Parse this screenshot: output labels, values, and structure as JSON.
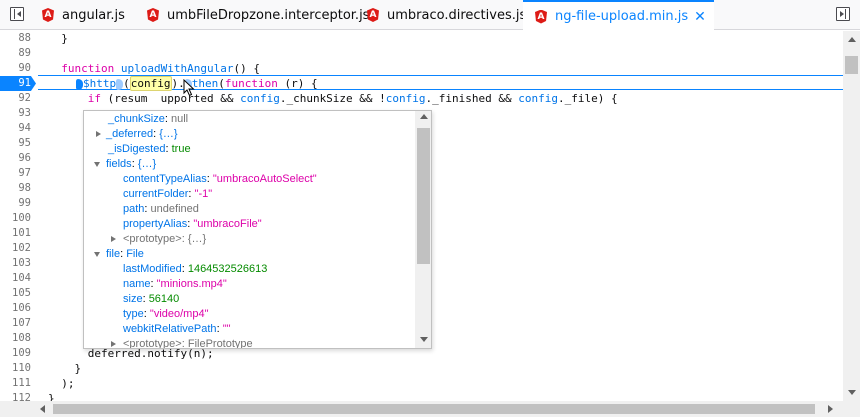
{
  "tabs": [
    {
      "label": "angular.js",
      "active": false
    },
    {
      "label": "umbFileDropzone.interceptor.js",
      "active": false
    },
    {
      "label": "umbraco.directives.js",
      "active": false
    },
    {
      "label": "ng-file-upload.min.js",
      "active": true
    }
  ],
  "tab_icon_letter": "A",
  "close_glyph": "✕",
  "editor": {
    "lines": [
      {
        "n": "88",
        "code": "  }"
      },
      {
        "n": "89",
        "code": ""
      },
      {
        "n": "90",
        "code": "  function uploadWithAngular() {"
      },
      {
        "n": "91",
        "code": "    $http  (config).  then(function (r) {",
        "breakpoint": true
      },
      {
        "n": "92",
        "code": "      if (resum  upported && config._chunkSize && !config._finished && config._file) {"
      },
      {
        "n": "93",
        "code": ""
      },
      {
        "n": "94",
        "code": ""
      },
      {
        "n": "95",
        "code": ""
      },
      {
        "n": "96",
        "code": ""
      },
      {
        "n": "97",
        "code": ""
      },
      {
        "n": "98",
        "code": ""
      },
      {
        "n": "99",
        "code": ""
      },
      {
        "n": "100",
        "code": ""
      },
      {
        "n": "101",
        "code": ""
      },
      {
        "n": "102",
        "code": ""
      },
      {
        "n": "103",
        "code": ""
      },
      {
        "n": "104",
        "code": ""
      },
      {
        "n": "105",
        "code": ""
      },
      {
        "n": "106",
        "code": ""
      },
      {
        "n": "107",
        "code": ""
      },
      {
        "n": "108",
        "code": ""
      },
      {
        "n": "109",
        "code": "      deferred.notify(n);"
      },
      {
        "n": "110",
        "code": "    }"
      },
      {
        "n": "111",
        "code": "  );"
      },
      {
        "n": "112",
        "code": "}"
      }
    ]
  },
  "popup": {
    "rows": [
      {
        "indent": 0,
        "twisty": "none",
        "key": "_chunkSize",
        "value": "null",
        "vtype": "null"
      },
      {
        "indent": 0,
        "twisty": "closed",
        "key": "_deferred",
        "value": "{…}",
        "vtype": "obj"
      },
      {
        "indent": 0,
        "twisty": "none",
        "key": "_isDigested",
        "value": "true",
        "vtype": "bool"
      },
      {
        "indent": 0,
        "twisty": "open",
        "key": "fields",
        "value": "{…}",
        "vtype": "obj"
      },
      {
        "indent": 1,
        "twisty": "none",
        "key": "contentTypeAlias",
        "value": "\"umbracoAutoSelect\"",
        "vtype": "str"
      },
      {
        "indent": 1,
        "twisty": "none",
        "key": "currentFolder",
        "value": "\"-1\"",
        "vtype": "str"
      },
      {
        "indent": 1,
        "twisty": "none",
        "key": "path",
        "value": "undefined",
        "vtype": "null"
      },
      {
        "indent": 1,
        "twisty": "none",
        "key": "propertyAlias",
        "value": "\"umbracoFile\"",
        "vtype": "str"
      },
      {
        "indent": 1,
        "twisty": "closed",
        "key": "<prototype>",
        "value": "{…}",
        "vtype": "dim",
        "proto": true
      },
      {
        "indent": 0,
        "twisty": "open",
        "key": "file",
        "value": "File",
        "vtype": "obj"
      },
      {
        "indent": 1,
        "twisty": "none",
        "key": "lastModified",
        "value": "1464532526613",
        "vtype": "num"
      },
      {
        "indent": 1,
        "twisty": "none",
        "key": "name",
        "value": "\"minions.mp4\"",
        "vtype": "str"
      },
      {
        "indent": 1,
        "twisty": "none",
        "key": "size",
        "value": "56140",
        "vtype": "num"
      },
      {
        "indent": 1,
        "twisty": "none",
        "key": "type",
        "value": "\"video/mp4\"",
        "vtype": "str"
      },
      {
        "indent": 1,
        "twisty": "none",
        "key": "webkitRelativePath",
        "value": "\"\"",
        "vtype": "str"
      },
      {
        "indent": 1,
        "twisty": "closed",
        "key": "<prototype>",
        "value": "FilePrototype",
        "vtype": "dim",
        "proto": true
      }
    ]
  },
  "colors": {
    "accent": "#0a84ff",
    "angular_red": "#dd1b16",
    "keyword": "#dd00a9",
    "string": "#dd00a9",
    "number": "#058b00"
  }
}
